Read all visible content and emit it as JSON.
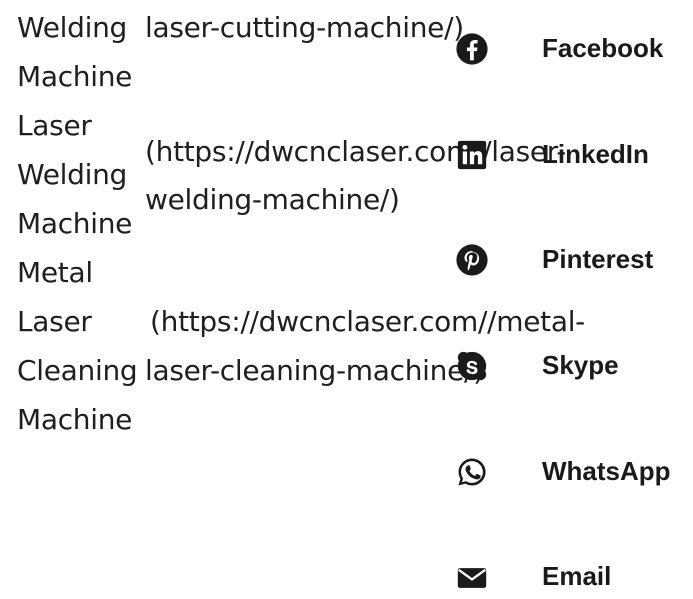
{
  "product_list": {
    "col1_lines": [
      "Welding",
      "Machine",
      "Laser",
      "Welding",
      "Machine",
      "Metal",
      "Laser",
      "Cleaning",
      "Machine"
    ],
    "link_fragments": [
      "laser-cutting-machine/)",
      "(https://dwcnclaser.com//laser-",
      "welding-machine/)",
      "(https://dwcnclaser.com//metal-",
      "laser-cleaning-machine/)"
    ]
  },
  "share": {
    "items": [
      {
        "label": "Facebook",
        "icon": "facebook-icon"
      },
      {
        "label": "LinkedIn",
        "icon": "linkedin-icon"
      },
      {
        "label": "Pinterest",
        "icon": "pinterest-icon"
      },
      {
        "label": "Skype",
        "icon": "skype-icon"
      },
      {
        "label": "WhatsApp",
        "icon": "whatsapp-icon"
      },
      {
        "label": "Email",
        "icon": "email-icon"
      }
    ]
  }
}
